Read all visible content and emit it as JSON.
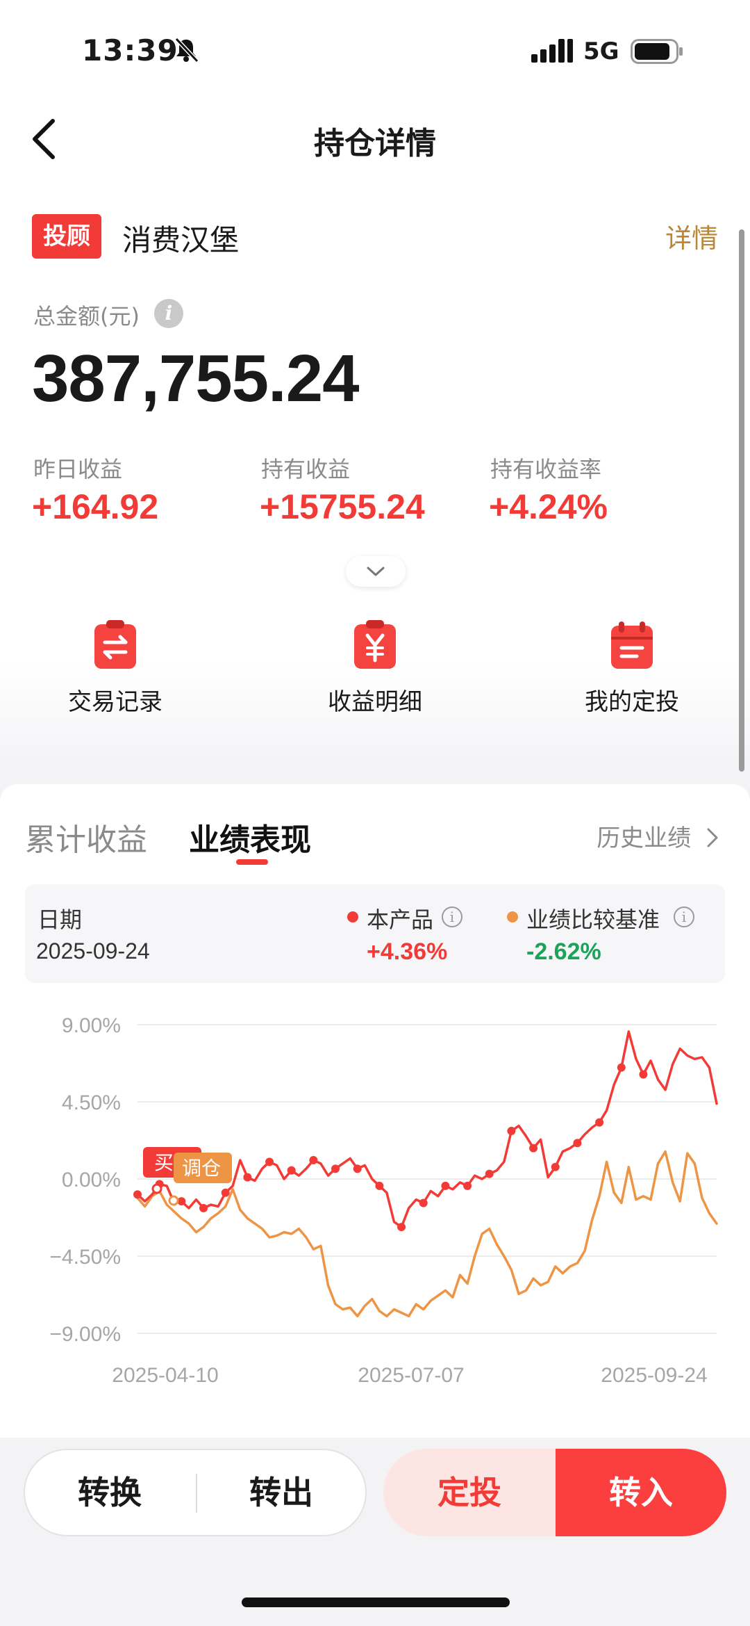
{
  "status": {
    "time": "13:39",
    "network": "5G"
  },
  "nav": {
    "title": "持仓详情"
  },
  "product": {
    "tag": "投顾",
    "name": "消费汉堡",
    "detail_link": "详情"
  },
  "summary": {
    "amount_label": "总金额(元)",
    "amount": "387,755.24",
    "stats": [
      {
        "label": "昨日收益",
        "value": "+164.92"
      },
      {
        "label": "持有收益",
        "value": "+15755.24"
      },
      {
        "label": "持有收益率",
        "value": "+4.24%"
      }
    ]
  },
  "quick_actions": [
    {
      "label": "交易记录",
      "icon": "transfer-doc-icon"
    },
    {
      "label": "收益明细",
      "icon": "yuan-doc-icon"
    },
    {
      "label": "我的定投",
      "icon": "calendar-icon"
    }
  ],
  "tabs": {
    "items": [
      "累计收益",
      "业绩表现"
    ],
    "active": 1,
    "history_link": "历史业绩"
  },
  "legend": {
    "date_label": "日期",
    "date_value": "2025-09-24",
    "product_label": "本产品",
    "product_value": "+4.36%",
    "benchmark_label": "业绩比较基准",
    "benchmark_value": "-2.62%"
  },
  "colors": {
    "accent": "#F23B36",
    "benchmark": "#EE9445",
    "positive": "#F23B36",
    "negative": "#1BA35A",
    "gold": "#B98739"
  },
  "chart_data": {
    "type": "line",
    "y_tick_labels": [
      "9.00%",
      "4.50%",
      "0.00%",
      "−4.50%",
      "−9.00%"
    ],
    "y_ticks": [
      9,
      4.5,
      0,
      -4.5,
      -9
    ],
    "ylim": [
      -9,
      9
    ],
    "x_tick_labels": [
      "2025-04-10",
      "2025-07-07",
      "2025-09-24"
    ],
    "grid": true,
    "markers": {
      "buy": "买",
      "rebalance": "调仓"
    },
    "series": [
      {
        "name": "本产品",
        "color": "#F23B36",
        "values": [
          -0.9,
          -1.3,
          -0.9,
          -0.3,
          -0.4,
          -1.4,
          -1.3,
          -1.7,
          -1.2,
          -1.7,
          -1.5,
          -1.6,
          -0.8,
          -0.4,
          1.1,
          0.1,
          -0.1,
          0.6,
          1.0,
          0.8,
          0.0,
          0.5,
          0.2,
          0.6,
          1.1,
          0.9,
          0.2,
          0.6,
          0.9,
          1.2,
          0.6,
          0.8,
          0.0,
          -0.4,
          -0.8,
          -2.5,
          -2.8,
          -1.7,
          -1.2,
          -1.4,
          -0.7,
          -1.0,
          -0.4,
          -0.6,
          -0.2,
          -0.4,
          0.2,
          0.0,
          0.3,
          0.5,
          1.0,
          2.8,
          3.1,
          2.5,
          1.8,
          2.3,
          0.1,
          0.7,
          1.6,
          1.8,
          2.1,
          2.6,
          3.0,
          3.3,
          4.0,
          5.5,
          6.5,
          8.6,
          7.0,
          6.1,
          6.9,
          5.8,
          5.2,
          6.7,
          7.6,
          7.2,
          7.0,
          7.1,
          6.5,
          4.4
        ]
      },
      {
        "name": "业绩比较基准",
        "color": "#EE9445",
        "values": [
          -1.1,
          -1.6,
          -1.0,
          -0.7,
          -1.5,
          -1.9,
          -2.3,
          -2.6,
          -3.1,
          -2.8,
          -2.3,
          -2.0,
          -1.6,
          -0.6,
          -1.8,
          -2.3,
          -2.6,
          -2.9,
          -3.4,
          -3.3,
          -3.1,
          -3.2,
          -2.9,
          -3.4,
          -4.1,
          -3.9,
          -6.2,
          -7.3,
          -7.6,
          -7.5,
          -8.0,
          -7.4,
          -7.0,
          -7.7,
          -8.0,
          -7.6,
          -7.8,
          -8.0,
          -7.3,
          -7.6,
          -7.1,
          -6.8,
          -6.5,
          -6.9,
          -5.6,
          -6.1,
          -4.5,
          -3.2,
          -2.9,
          -3.8,
          -4.5,
          -5.3,
          -6.7,
          -6.5,
          -5.8,
          -6.2,
          -6.0,
          -5.1,
          -5.5,
          -5.1,
          -4.9,
          -4.2,
          -2.4,
          -1.0,
          1.0,
          -0.8,
          -1.4,
          0.7,
          -1.2,
          -1.0,
          -1.2,
          0.9,
          1.6,
          -0.2,
          -1.3,
          1.5,
          0.9,
          -1.1,
          -2.0,
          -2.6
        ]
      }
    ]
  },
  "bottom": {
    "convert": "转换",
    "redeem": "转出",
    "auto_invest": "定投",
    "buy": "转入"
  }
}
